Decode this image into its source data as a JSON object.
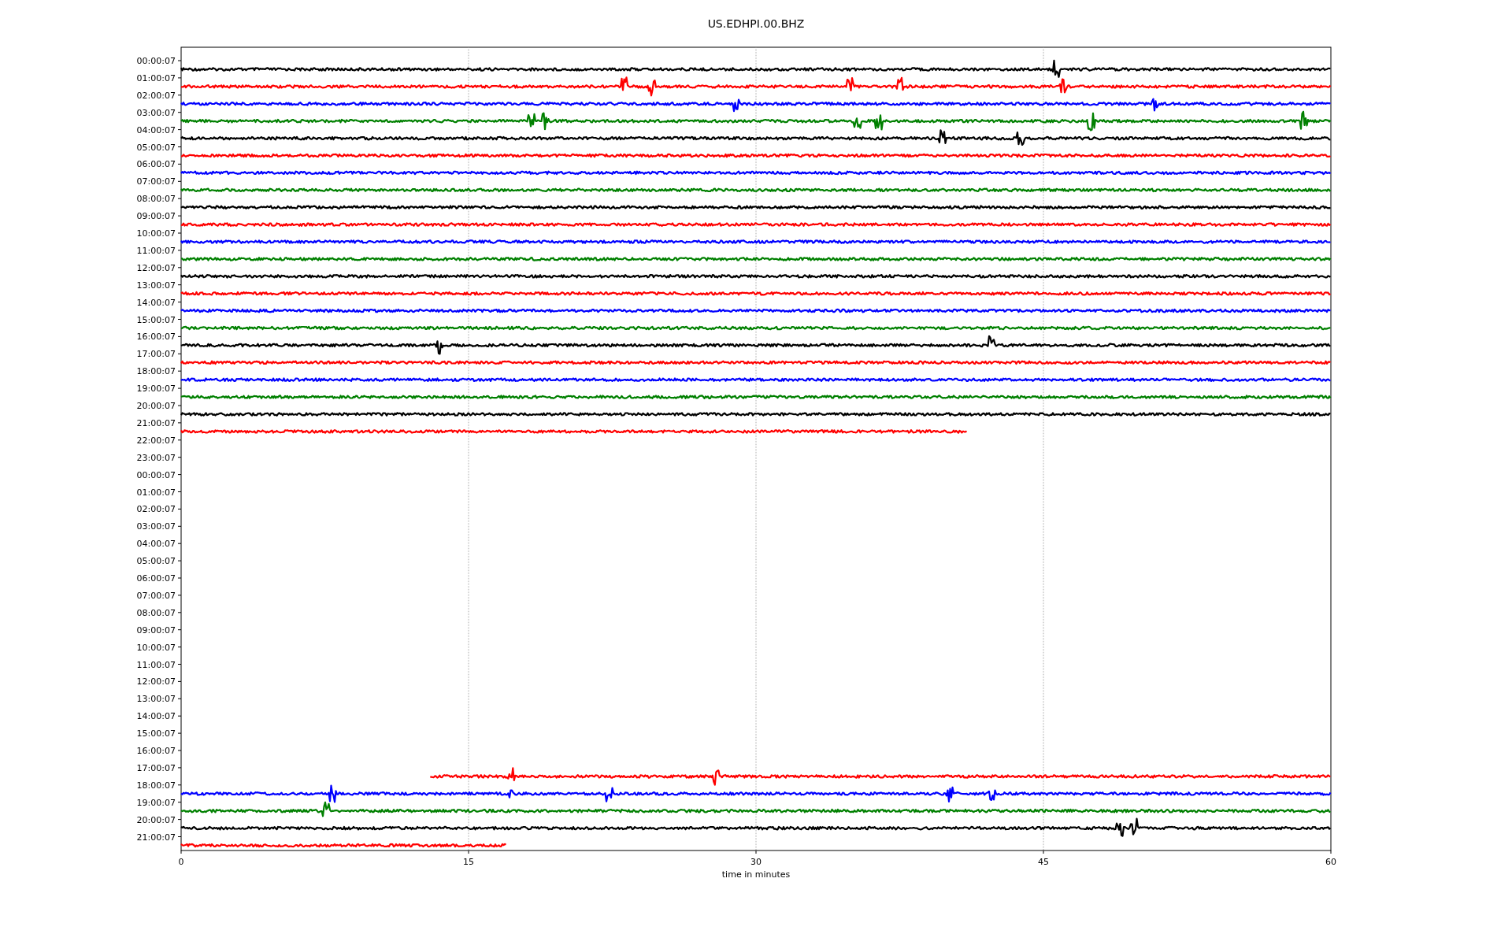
{
  "plot": {
    "title": "US.EDHPI.00.BHZ",
    "xlabel": "time in minutes",
    "x_tick_labels": [
      "0",
      "15",
      "30",
      "45",
      "60"
    ],
    "rows": [
      {
        "label": "00:00:07",
        "trace": {
          "color": "#000000",
          "kind": "full"
        }
      },
      {
        "label": "01:00:07",
        "trace": {
          "color": "#ff0000",
          "kind": "full"
        }
      },
      {
        "label": "02:00:07",
        "trace": {
          "color": "#0000ff",
          "kind": "full"
        }
      },
      {
        "label": "03:00:07",
        "trace": {
          "color": "#008000",
          "kind": "full"
        }
      },
      {
        "label": "04:00:07",
        "trace": {
          "color": "#000000",
          "kind": "full"
        }
      },
      {
        "label": "05:00:07",
        "trace": {
          "color": "#ff0000",
          "kind": "full"
        }
      },
      {
        "label": "06:00:07",
        "trace": {
          "color": "#0000ff",
          "kind": "full"
        }
      },
      {
        "label": "07:00:07",
        "trace": {
          "color": "#008000",
          "kind": "full"
        }
      },
      {
        "label": "08:00:07",
        "trace": {
          "color": "#000000",
          "kind": "full"
        }
      },
      {
        "label": "09:00:07",
        "trace": {
          "color": "#ff0000",
          "kind": "full"
        }
      },
      {
        "label": "10:00:07",
        "trace": {
          "color": "#0000ff",
          "kind": "full"
        }
      },
      {
        "label": "11:00:07",
        "trace": {
          "color": "#008000",
          "kind": "full"
        }
      },
      {
        "label": "12:00:07",
        "trace": {
          "color": "#000000",
          "kind": "full"
        }
      },
      {
        "label": "13:00:07",
        "trace": {
          "color": "#ff0000",
          "kind": "full"
        }
      },
      {
        "label": "14:00:07",
        "trace": {
          "color": "#0000ff",
          "kind": "full"
        }
      },
      {
        "label": "15:00:07",
        "trace": {
          "color": "#008000",
          "kind": "full"
        }
      },
      {
        "label": "16:00:07",
        "trace": {
          "color": "#000000",
          "kind": "full"
        }
      },
      {
        "label": "17:00:07",
        "trace": {
          "color": "#ff0000",
          "kind": "full"
        }
      },
      {
        "label": "18:00:07",
        "trace": {
          "color": "#0000ff",
          "kind": "full"
        }
      },
      {
        "label": "19:00:07",
        "trace": {
          "color": "#008000",
          "kind": "full"
        }
      },
      {
        "label": "20:00:07",
        "trace": {
          "color": "#000000",
          "kind": "full"
        }
      },
      {
        "label": "21:00:07",
        "trace": {
          "color": "#ff0000",
          "kind": "ends-early"
        }
      },
      {
        "label": "22:00:07"
      },
      {
        "label": "23:00:07"
      },
      {
        "label": "00:00:07"
      },
      {
        "label": "01:00:07"
      },
      {
        "label": "02:00:07"
      },
      {
        "label": "03:00:07"
      },
      {
        "label": "04:00:07"
      },
      {
        "label": "05:00:07"
      },
      {
        "label": "06:00:07"
      },
      {
        "label": "07:00:07"
      },
      {
        "label": "08:00:07"
      },
      {
        "label": "09:00:07"
      },
      {
        "label": "10:00:07"
      },
      {
        "label": "11:00:07"
      },
      {
        "label": "12:00:07"
      },
      {
        "label": "13:00:07"
      },
      {
        "label": "14:00:07"
      },
      {
        "label": "15:00:07"
      },
      {
        "label": "16:00:07"
      },
      {
        "label": "17:00:07",
        "trace": {
          "color": "#ff0000",
          "kind": "starts-late"
        }
      },
      {
        "label": "18:00:07",
        "trace": {
          "color": "#0000ff",
          "kind": "full"
        }
      },
      {
        "label": "19:00:07",
        "trace": {
          "color": "#008000",
          "kind": "full"
        }
      },
      {
        "label": "20:00:07",
        "trace": {
          "color": "#000000",
          "kind": "full"
        }
      },
      {
        "label": "21:00:07",
        "trace": {
          "color": "#ff0000",
          "kind": "short"
        }
      }
    ]
  }
}
